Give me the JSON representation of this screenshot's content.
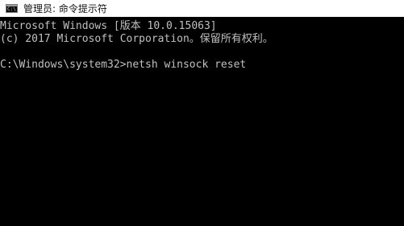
{
  "window": {
    "title": "管理员: 命令提示符",
    "icon": "console-icon",
    "icon_glyph": "C:\\"
  },
  "console": {
    "lines": [
      "Microsoft Windows [版本 10.0.15063]",
      "(c) 2017 Microsoft Corporation。保留所有权利。",
      "",
      "C:\\Windows\\system32>netsh winsock reset"
    ]
  },
  "colors": {
    "background": "#000000",
    "text": "#c0c0c0",
    "titlebar": "#ffffff"
  }
}
